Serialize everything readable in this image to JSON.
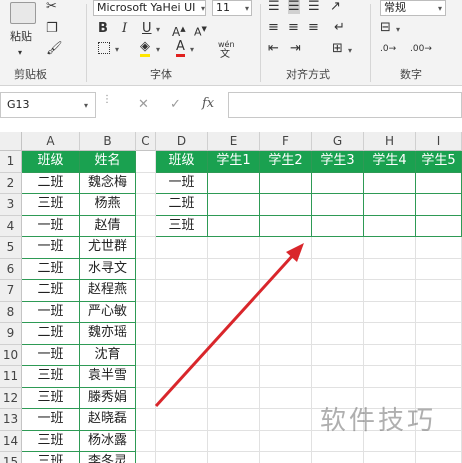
{
  "ribbon": {
    "clipboard": {
      "label": "剪贴板",
      "paste": "粘贴"
    },
    "font": {
      "label": "字体",
      "name": "Microsoft YaHei UI",
      "size": "11",
      "wen": "wén"
    },
    "alignment": {
      "label": "对齐方式"
    },
    "number": {
      "label": "数字",
      "format": "常规"
    }
  },
  "formula_bar": {
    "name_box": "G13",
    "fx": "fx",
    "cancel": "✕",
    "enter": "✓",
    "content": ""
  },
  "grid": {
    "columns": [
      "A",
      "B",
      "C",
      "D",
      "E",
      "F",
      "G",
      "H",
      "I"
    ],
    "rows": [
      "1",
      "2",
      "3",
      "4",
      "5",
      "6",
      "7",
      "8",
      "9",
      "10",
      "11",
      "12",
      "13",
      "14",
      "15"
    ],
    "left_table": {
      "headers": [
        "班级",
        "姓名"
      ],
      "rows": [
        [
          "二班",
          "魏念梅"
        ],
        [
          "三班",
          "杨燕"
        ],
        [
          "一班",
          "赵倩"
        ],
        [
          "一班",
          "尤世群"
        ],
        [
          "二班",
          "水寻文"
        ],
        [
          "二班",
          "赵程燕"
        ],
        [
          "一班",
          "严心敏"
        ],
        [
          "二班",
          "魏亦瑶"
        ],
        [
          "一班",
          "沈育"
        ],
        [
          "三班",
          "袁半雪"
        ],
        [
          "三班",
          "滕秀娟"
        ],
        [
          "一班",
          "赵晓磊"
        ],
        [
          "三班",
          "杨冰露"
        ],
        [
          "三班",
          "李冬灵"
        ]
      ]
    },
    "right_table": {
      "headers": [
        "班级",
        "学生1",
        "学生2",
        "学生3",
        "学生4",
        "学生5"
      ],
      "classes": [
        "一班",
        "二班",
        "三班"
      ]
    }
  },
  "watermark": "软件技巧",
  "colors": {
    "header_green": "#1aa150",
    "arrow_red": "#d9262b",
    "ribbon_bg": "#f3f3f3"
  }
}
